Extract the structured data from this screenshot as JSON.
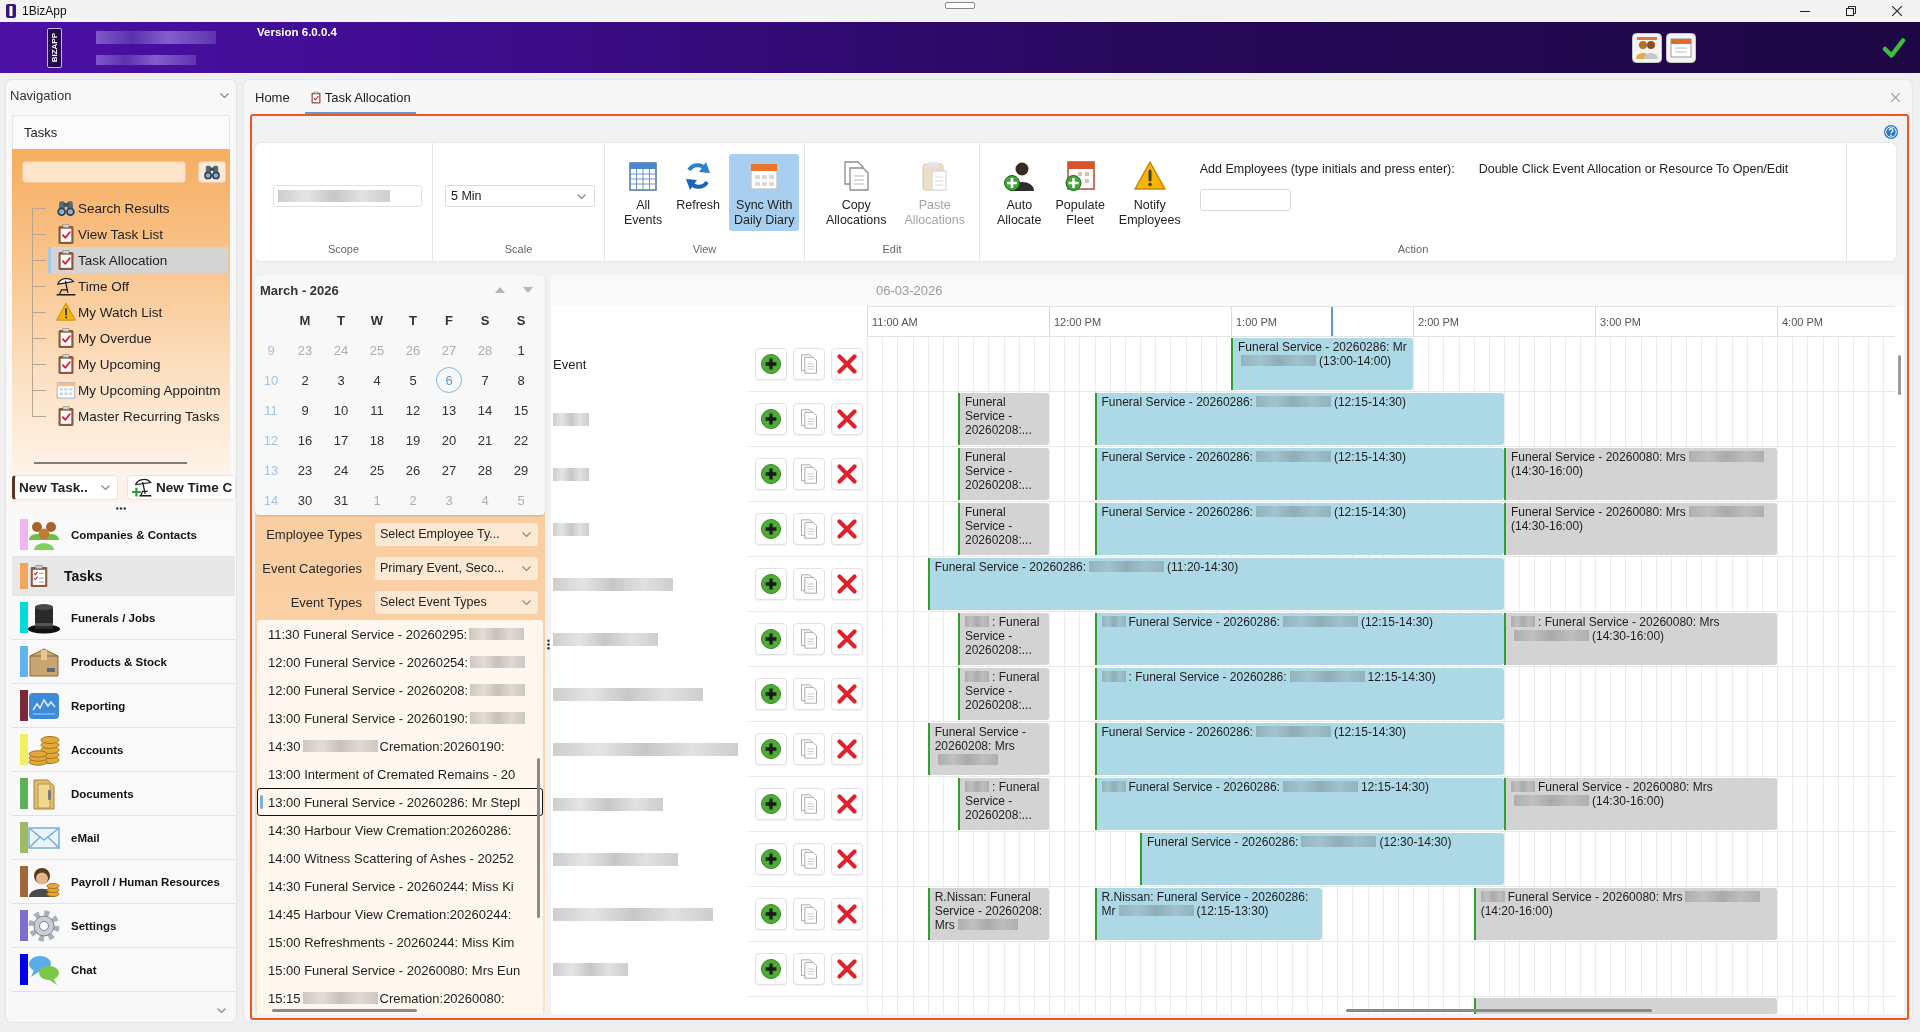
{
  "window": {
    "title": "1BizApp"
  },
  "header": {
    "logo": "BIZAPP",
    "details": [
      {
        "kind": "blur"
      },
      {
        "kind": "blur"
      }
    ],
    "version": "Version 6.0.0.4"
  },
  "navigation": {
    "title": "Navigation",
    "section": "Tasks",
    "tree": [
      {
        "label": "Search Results",
        "selected": false
      },
      {
        "label": "View Task List",
        "selected": false
      },
      {
        "label": "Task Allocation",
        "selected": true
      },
      {
        "label": "Time Off",
        "selected": false
      },
      {
        "label": "My Watch List",
        "selected": false
      },
      {
        "label": "My Overdue",
        "selected": false
      },
      {
        "label": "My Upcoming",
        "selected": false
      },
      {
        "label": "My Upcoming Appointm",
        "selected": false
      },
      {
        "label": "Master Recurring Tasks",
        "selected": false
      }
    ],
    "actions": [
      {
        "kind": "dropdown",
        "label": "New Task.."
      },
      {
        "kind": "button",
        "label": "New Time C"
      }
    ],
    "modules": [
      {
        "label": "Companies & Contacts",
        "color": "#f0b4ee",
        "selected": false
      },
      {
        "label": "Tasks",
        "color": "#f5a65b",
        "selected": true
      },
      {
        "label": "Funerals / Jobs",
        "color": "#00d9d9",
        "selected": false
      },
      {
        "label": "Products & Stock",
        "color": "#62b4f0",
        "selected": false
      },
      {
        "label": "Reporting",
        "color": "#7a2a3a",
        "selected": false
      },
      {
        "label": "Accounts",
        "color": "#f0ef60",
        "selected": false
      },
      {
        "label": "Documents",
        "color": "#5cb05c",
        "selected": false
      },
      {
        "label": "eMail",
        "color": "#9eba62",
        "selected": false
      },
      {
        "label": "Payroll / Human Resources",
        "color": "#a0683a",
        "selected": false
      },
      {
        "label": "Settings",
        "color": "#7e6ed0",
        "selected": false
      },
      {
        "label": "Chat",
        "color": "#0000f0",
        "selected": false
      }
    ]
  },
  "tabs": [
    {
      "label": "Home",
      "selected": false
    },
    {
      "label": "Task Allocation",
      "selected": true
    }
  ],
  "ribbon": {
    "scope": {
      "caption": "Scope",
      "value": [
        {
          "kind": "blur"
        }
      ]
    },
    "scale": {
      "caption": "Scale",
      "value": "5 Min"
    },
    "view": {
      "caption": "View",
      "buttons": [
        {
          "label": "All Events",
          "on": false
        },
        {
          "label": "Refresh",
          "on": false
        },
        {
          "label": "Sync With Daily Diary",
          "on": true
        }
      ]
    },
    "edit": {
      "caption": "Edit",
      "buttons": [
        {
          "label": "Copy Allocations",
          "disabled": false
        },
        {
          "label": "Paste Allocations",
          "disabled": true
        }
      ]
    },
    "action": {
      "caption": "Action",
      "buttons": [
        {
          "label": "Auto Allocate"
        },
        {
          "label": "Populate Fleet"
        },
        {
          "label": "Notify Employees"
        }
      ],
      "employee_label": "Add Employees (type initials and press enter):",
      "hint": "Double Click Event Allocation or Resource To Open/Edit"
    }
  },
  "calendar": {
    "title": "March - 2026",
    "weekdays": [
      "M",
      "T",
      "W",
      "T",
      "F",
      "S",
      "S"
    ],
    "weeks": [
      {
        "number": "9",
        "days": [
          {
            "label": "23",
            "outside": true,
            "selected": false
          },
          {
            "label": "24",
            "outside": true,
            "selected": false
          },
          {
            "label": "25",
            "outside": true,
            "selected": false
          },
          {
            "label": "26",
            "outside": true,
            "selected": false
          },
          {
            "label": "27",
            "outside": true,
            "selected": false
          },
          {
            "label": "28",
            "outside": true,
            "selected": false
          },
          {
            "label": "1",
            "outside": false,
            "selected": false
          }
        ]
      },
      {
        "number": "10",
        "days": [
          {
            "label": "2",
            "outside": false,
            "selected": false
          },
          {
            "label": "3",
            "outside": false,
            "selected": false
          },
          {
            "label": "4",
            "outside": false,
            "selected": false
          },
          {
            "label": "5",
            "outside": false,
            "selected": false
          },
          {
            "label": "6",
            "outside": false,
            "selected": true
          },
          {
            "label": "7",
            "outside": false,
            "selected": false
          },
          {
            "label": "8",
            "outside": false,
            "selected": false
          }
        ]
      },
      {
        "number": "11",
        "days": [
          {
            "label": "9",
            "outside": false,
            "selected": false
          },
          {
            "label": "10",
            "outside": false,
            "selected": false
          },
          {
            "label": "11",
            "outside": false,
            "selected": false
          },
          {
            "label": "12",
            "outside": false,
            "selected": false
          },
          {
            "label": "13",
            "outside": false,
            "selected": false
          },
          {
            "label": "14",
            "outside": false,
            "selected": false
          },
          {
            "label": "15",
            "outside": false,
            "selected": false
          }
        ]
      },
      {
        "number": "12",
        "days": [
          {
            "label": "16",
            "outside": false,
            "selected": false
          },
          {
            "label": "17",
            "outside": false,
            "selected": false
          },
          {
            "label": "18",
            "outside": false,
            "selected": false
          },
          {
            "label": "19",
            "outside": false,
            "selected": false
          },
          {
            "label": "20",
            "outside": false,
            "selected": false
          },
          {
            "label": "21",
            "outside": false,
            "selected": false
          },
          {
            "label": "22",
            "outside": false,
            "selected": false
          }
        ]
      },
      {
        "number": "13",
        "days": [
          {
            "label": "23",
            "outside": false,
            "selected": false
          },
          {
            "label": "24",
            "outside": false,
            "selected": false
          },
          {
            "label": "25",
            "outside": false,
            "selected": false
          },
          {
            "label": "26",
            "outside": false,
            "selected": false
          },
          {
            "label": "27",
            "outside": false,
            "selected": false
          },
          {
            "label": "28",
            "outside": false,
            "selected": false
          },
          {
            "label": "29",
            "outside": false,
            "selected": false
          }
        ]
      },
      {
        "number": "14",
        "days": [
          {
            "label": "30",
            "outside": false,
            "selected": false
          },
          {
            "label": "31",
            "outside": false,
            "selected": false
          },
          {
            "label": "1",
            "outside": true,
            "selected": false
          },
          {
            "label": "2",
            "outside": true,
            "selected": false
          },
          {
            "label": "3",
            "outside": true,
            "selected": false
          },
          {
            "label": "4",
            "outside": true,
            "selected": false
          },
          {
            "label": "5",
            "outside": true,
            "selected": false
          }
        ]
      }
    ]
  },
  "filters": [
    {
      "label": "Employee Types",
      "value": "Select Employee Ty..."
    },
    {
      "label": "Event Categories",
      "value": "Primary Event, Seco..."
    },
    {
      "label": "Event Types",
      "value": "Select Event Types"
    }
  ],
  "event_list": [
    {
      "segments": [
        {
          "kind": "text",
          "text": "11:30 Funeral Service - 20260295:"
        },
        {
          "kind": "blur"
        }
      ],
      "selected": false
    },
    {
      "segments": [
        {
          "kind": "text",
          "text": "12:00 Funeral Service - 20260254:"
        },
        {
          "kind": "blur"
        }
      ],
      "selected": false
    },
    {
      "segments": [
        {
          "kind": "text",
          "text": "12:00 Funeral Service - 20260208:"
        },
        {
          "kind": "blur"
        }
      ],
      "selected": false
    },
    {
      "segments": [
        {
          "kind": "text",
          "text": "13:00 Funeral Service - 20260190:"
        },
        {
          "kind": "blur"
        }
      ],
      "selected": false
    },
    {
      "segments": [
        {
          "kind": "text",
          "text": "14:30"
        },
        {
          "kind": "blur"
        },
        {
          "kind": "text",
          "text": "Cremation:20260190:"
        }
      ],
      "selected": false
    },
    {
      "segments": [
        {
          "kind": "text",
          "text": "13:00 Interment of Cremated Remains - 20"
        }
      ],
      "selected": false
    },
    {
      "segments": [
        {
          "kind": "text",
          "text": "13:00 Funeral Service - 20260286: Mr Stepl"
        }
      ],
      "selected": true
    },
    {
      "segments": [
        {
          "kind": "text",
          "text": "14:30 Harbour View Cremation:20260286:"
        }
      ],
      "selected": false
    },
    {
      "segments": [
        {
          "kind": "text",
          "text": "14:00 Witness Scattering of Ashes - 20252"
        }
      ],
      "selected": false
    },
    {
      "segments": [
        {
          "kind": "text",
          "text": "14:30 Funeral Service - 20260244: Miss Ki"
        }
      ],
      "selected": false
    },
    {
      "segments": [
        {
          "kind": "text",
          "text": "14:45 Harbour View Cremation:20260244:"
        }
      ],
      "selected": false
    },
    {
      "segments": [
        {
          "kind": "text",
          "text": "15:00 Refreshments - 20260244: Miss Kim"
        }
      ],
      "selected": false
    },
    {
      "segments": [
        {
          "kind": "text",
          "text": "15:00 Funeral Service - 20260080: Mrs Eun"
        }
      ],
      "selected": false
    },
    {
      "segments": [
        {
          "kind": "text",
          "text": "15:15"
        },
        {
          "kind": "blur"
        },
        {
          "kind": "text",
          "text": "Cremation:20260080:"
        }
      ],
      "selected": false
    }
  ],
  "schedule": {
    "date": "06-03-2026",
    "hours": [
      "11:00 AM",
      "12:00 PM",
      "1:00 PM",
      "2:00 PM",
      "3:00 PM",
      "4:00 PM"
    ],
    "rows": [
      {
        "name": [
          {
            "kind": "text",
            "text": "Event"
          }
        ],
        "events": [
          {
            "color": "#add8e6",
            "segments": [
              {
                "kind": "text",
                "text": "Funeral Service - 20260286: Mr"
              },
              {
                "kind": "blur"
              },
              {
                "kind": "text",
                "text": "(13:00-14:00)"
              }
            ]
          }
        ]
      },
      {
        "name": [
          {
            "kind": "blur"
          }
        ],
        "events": [
          {
            "color": "#d3d3d3",
            "segments": [
              {
                "kind": "text",
                "text": "Funeral Service - 20260208:..."
              }
            ]
          },
          {
            "color": "#add8e6",
            "segments": [
              {
                "kind": "text",
                "text": "Funeral Service - 20260286:"
              },
              {
                "kind": "blur"
              },
              {
                "kind": "text",
                "text": "(12:15-14:30)"
              }
            ]
          }
        ]
      },
      {
        "name": [
          {
            "kind": "blur"
          }
        ],
        "events": [
          {
            "color": "#d3d3d3",
            "segments": [
              {
                "kind": "text",
                "text": "Funeral Service - 20260208:..."
              }
            ]
          },
          {
            "color": "#add8e6",
            "segments": [
              {
                "kind": "text",
                "text": "Funeral Service - 20260286:"
              },
              {
                "kind": "blur"
              },
              {
                "kind": "text",
                "text": "(12:15-14:30)"
              }
            ]
          },
          {
            "color": "#d3d3d3",
            "segments": [
              {
                "kind": "text",
                "text": "Funeral Service - 20260080: Mrs"
              },
              {
                "kind": "blur"
              },
              {
                "kind": "text",
                "text": "(14:30-16:00)"
              }
            ]
          }
        ]
      },
      {
        "name": [
          {
            "kind": "blur"
          }
        ],
        "events": [
          {
            "color": "#d3d3d3",
            "segments": [
              {
                "kind": "text",
                "text": "Funeral Service - 20260208:..."
              }
            ]
          },
          {
            "color": "#add8e6",
            "segments": [
              {
                "kind": "text",
                "text": "Funeral Service - 20260286:"
              },
              {
                "kind": "blur"
              },
              {
                "kind": "text",
                "text": "(12:15-14:30)"
              }
            ]
          },
          {
            "color": "#d3d3d3",
            "segments": [
              {
                "kind": "text",
                "text": "Funeral Service - 20260080: Mrs"
              },
              {
                "kind": "blur"
              },
              {
                "kind": "text",
                "text": "(14:30-16:00)"
              }
            ]
          }
        ]
      },
      {
        "name": [
          {
            "kind": "blur"
          }
        ],
        "events": [
          {
            "color": "#add8e6",
            "segments": [
              {
                "kind": "text",
                "text": "Funeral Service - 20260286:"
              },
              {
                "kind": "blur"
              },
              {
                "kind": "text",
                "text": "(11:20-14:30)"
              }
            ]
          }
        ]
      },
      {
        "name": [
          {
            "kind": "blur"
          }
        ],
        "events": [
          {
            "color": "#d3d3d3",
            "segments": [
              {
                "kind": "blur"
              },
              {
                "kind": "text",
                "text": ": Funeral Service - 20260208:..."
              }
            ]
          },
          {
            "color": "#add8e6",
            "segments": [
              {
                "kind": "blur"
              },
              {
                "kind": "text",
                "text": "Funeral Service - 20260286:"
              },
              {
                "kind": "blur"
              },
              {
                "kind": "text",
                "text": "(12:15-14:30)"
              }
            ]
          },
          {
            "color": "#d3d3d3",
            "segments": [
              {
                "kind": "blur"
              },
              {
                "kind": "text",
                "text": ": Funeral Service - 20260080: Mrs"
              },
              {
                "kind": "blur"
              },
              {
                "kind": "text",
                "text": "(14:30-16:00)"
              }
            ]
          }
        ]
      },
      {
        "name": [
          {
            "kind": "blur"
          }
        ],
        "events": [
          {
            "color": "#d3d3d3",
            "segments": [
              {
                "kind": "blur"
              },
              {
                "kind": "text",
                "text": ": Funeral Service - 20260208:..."
              }
            ]
          },
          {
            "color": "#add8e6",
            "segments": [
              {
                "kind": "blur"
              },
              {
                "kind": "text",
                "text": ": Funeral Service - 20260286:"
              },
              {
                "kind": "blur"
              },
              {
                "kind": "text",
                "text": "12:15-14:30)"
              }
            ]
          }
        ]
      },
      {
        "name": [
          {
            "kind": "blur"
          }
        ],
        "events": [
          {
            "color": "#d3d3d3",
            "segments": [
              {
                "kind": "text",
                "text": "Funeral Service - 20260208: Mrs"
              },
              {
                "kind": "blur"
              }
            ]
          },
          {
            "color": "#add8e6",
            "segments": [
              {
                "kind": "text",
                "text": "Funeral Service - 20260286:"
              },
              {
                "kind": "blur"
              },
              {
                "kind": "text",
                "text": "(12:15-14:30)"
              }
            ]
          }
        ]
      },
      {
        "name": [
          {
            "kind": "blur"
          }
        ],
        "events": [
          {
            "color": "#d3d3d3",
            "segments": [
              {
                "kind": "blur"
              },
              {
                "kind": "text",
                "text": ": Funeral Service - 20260208:..."
              }
            ]
          },
          {
            "color": "#add8e6",
            "segments": [
              {
                "kind": "blur"
              },
              {
                "kind": "text",
                "text": "Funeral Service - 20260286:"
              },
              {
                "kind": "blur"
              },
              {
                "kind": "text",
                "text": "12:15-14:30)"
              }
            ]
          },
          {
            "color": "#d3d3d3",
            "segments": [
              {
                "kind": "blur"
              },
              {
                "kind": "text",
                "text": "Funeral Service - 20260080: Mrs"
              },
              {
                "kind": "blur"
              },
              {
                "kind": "text",
                "text": "(14:30-16:00)"
              }
            ]
          }
        ]
      },
      {
        "name": [
          {
            "kind": "blur"
          }
        ],
        "events": [
          {
            "color": "#add8e6",
            "segments": [
              {
                "kind": "text",
                "text": "Funeral Service - 20260286:"
              },
              {
                "kind": "blur"
              },
              {
                "kind": "text",
                "text": "(12:30-14:30)"
              }
            ]
          }
        ]
      },
      {
        "name": [
          {
            "kind": "blur"
          }
        ],
        "events": [
          {
            "color": "#d3d3d3",
            "segments": [
              {
                "kind": "text",
                "text": "R.Nissan: Funeral Service - 20260208: Mrs"
              },
              {
                "kind": "blur"
              }
            ]
          },
          {
            "color": "#add8e6",
            "segments": [
              {
                "kind": "text",
                "text": "R.Nissan: Funeral Service - 20260286: Mr"
              },
              {
                "kind": "blur"
              },
              {
                "kind": "text",
                "text": "(12:15-13:30)"
              }
            ]
          },
          {
            "color": "#d3d3d3",
            "segments": [
              {
                "kind": "blur"
              },
              {
                "kind": "text",
                "text": "Funeral Service - 20260080: Mrs"
              },
              {
                "kind": "blur"
              },
              {
                "kind": "text",
                "text": "(14:20-16:00)"
              }
            ]
          }
        ]
      },
      {
        "name": [
          {
            "kind": "blur"
          }
        ]
      }
    ],
    "cut_off_events": [
      {
        "color": "#d3d3d3"
      }
    ]
  }
}
